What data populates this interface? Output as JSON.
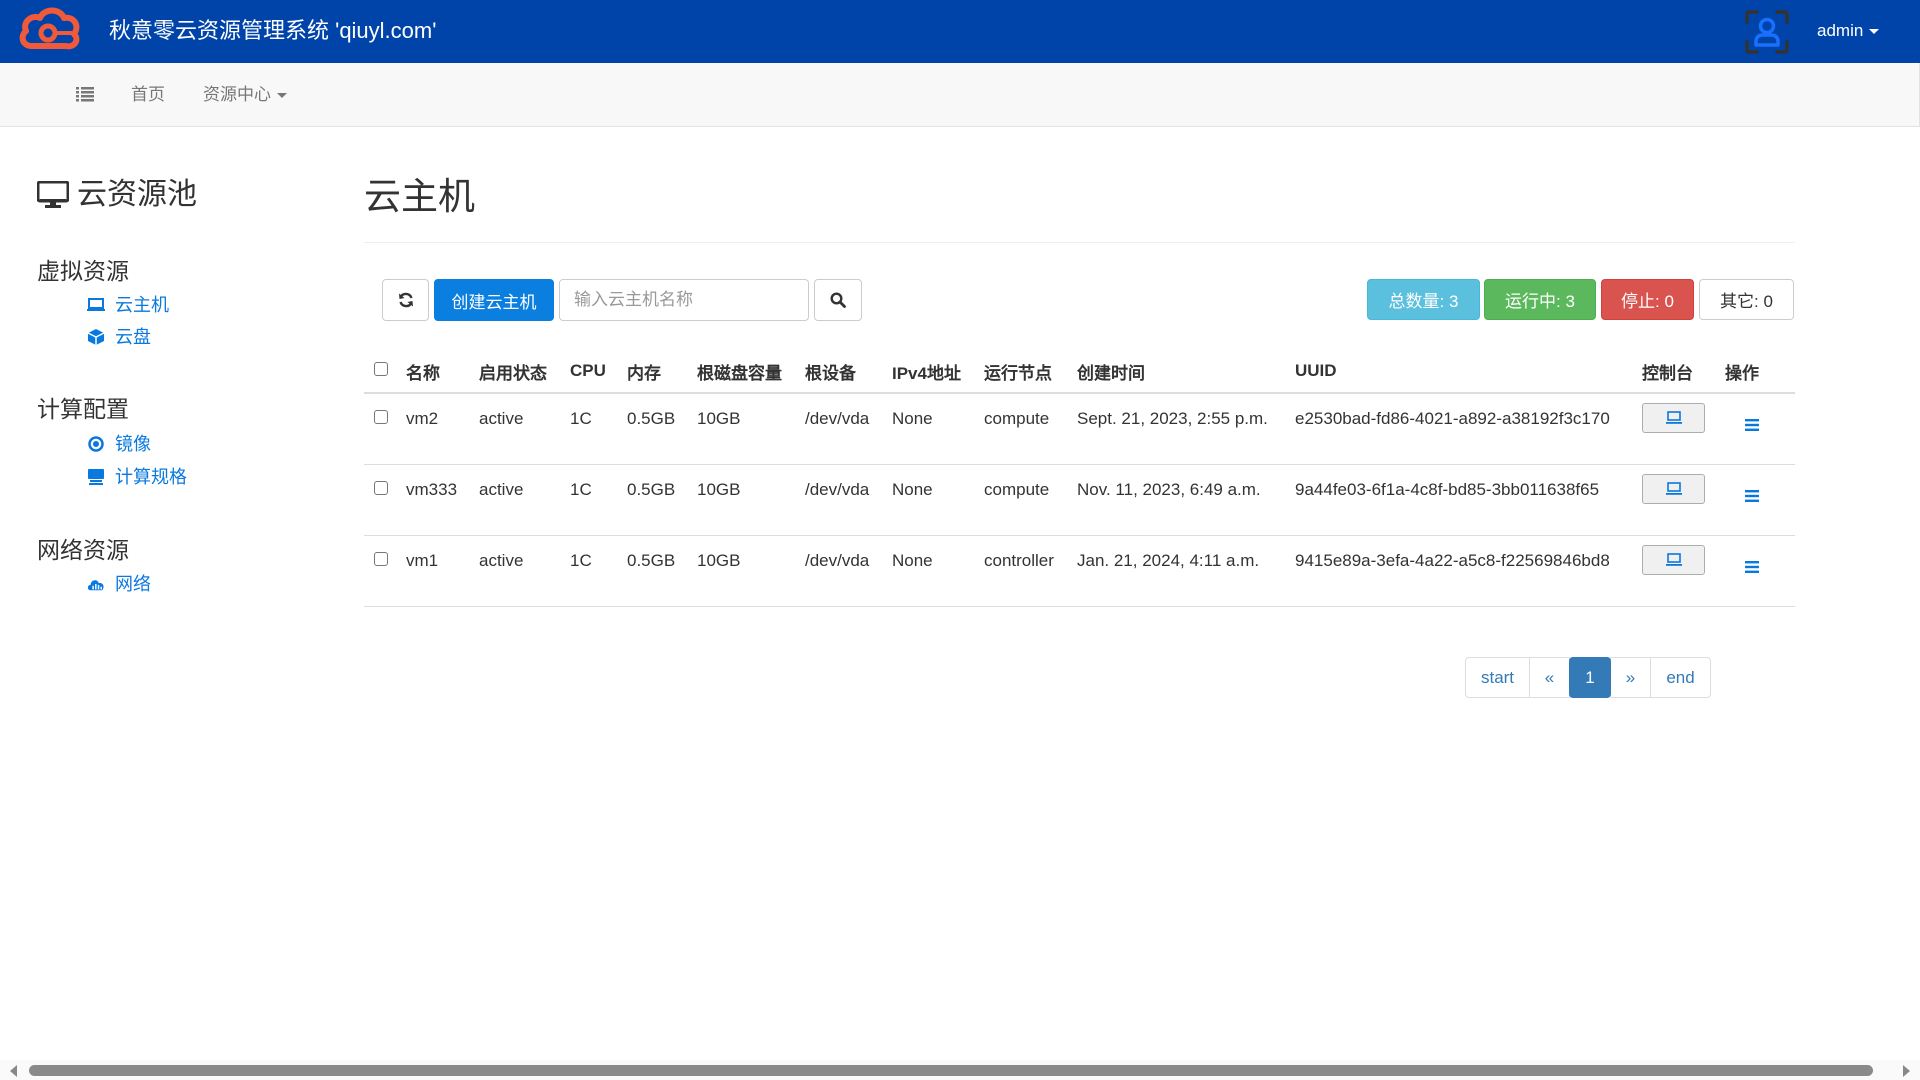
{
  "header": {
    "app_title": "秋意零云资源管理系统 'qiuyl.com'",
    "user_name": "admin",
    "brand_color": "#0044aa",
    "logo_color": "#f05a3a"
  },
  "navbar": {
    "items": [
      {
        "label": "首页"
      },
      {
        "label": "资源中心"
      }
    ]
  },
  "sidebar": {
    "title": "云资源池",
    "groups": [
      {
        "label": "虚拟资源",
        "items": [
          {
            "label": "云主机",
            "icon": "laptop-icon"
          },
          {
            "label": "云盘",
            "icon": "cube-icon"
          }
        ]
      },
      {
        "label": "计算配置",
        "items": [
          {
            "label": "镜像",
            "icon": "record-icon"
          },
          {
            "label": "计算规格",
            "icon": "blackboard-icon"
          }
        ]
      },
      {
        "label": "网络资源",
        "items": [
          {
            "label": "网络",
            "icon": "cloud-chart-icon"
          }
        ]
      }
    ]
  },
  "main": {
    "title": "云主机",
    "toolbar": {
      "create_label": "创建云主机",
      "search_placeholder": "输入云主机名称",
      "search_value": ""
    },
    "stats": [
      {
        "label": "总数量: 3",
        "color": "#5bc0de"
      },
      {
        "label": "运行中: 3",
        "color": "#5cb85c"
      },
      {
        "label": "停止: 0",
        "color": "#d9534f"
      },
      {
        "label": "其它: 0",
        "color": "#ffffff"
      }
    ],
    "table": {
      "columns": [
        "名称",
        "启用状态",
        "CPU",
        "内存",
        "根磁盘容量",
        "根设备",
        "IPv4地址",
        "运行节点",
        "创建时间",
        "UUID",
        "控制台",
        "操作"
      ],
      "rows": [
        {
          "name": "vm2",
          "status": "active",
          "cpu": "1C",
          "memory": "0.5GB",
          "disk": "10GB",
          "root_device": "/dev/vda",
          "ipv4": "None",
          "node": "compute",
          "created": "Sept. 21, 2023, 2:55 p.m.",
          "uuid": "e2530bad-fd86-4021-a892-a38192f3c170"
        },
        {
          "name": "vm333",
          "status": "active",
          "cpu": "1C",
          "memory": "0.5GB",
          "disk": "10GB",
          "root_device": "/dev/vda",
          "ipv4": "None",
          "node": "compute",
          "created": "Nov. 11, 2023, 6:49 a.m.",
          "uuid": "9a44fe03-6f1a-4c8f-bd85-3bb011638f65"
        },
        {
          "name": "vm1",
          "status": "active",
          "cpu": "1C",
          "memory": "0.5GB",
          "disk": "10GB",
          "root_device": "/dev/vda",
          "ipv4": "None",
          "node": "controller",
          "created": "Jan. 21, 2024, 4:11 a.m.",
          "uuid": "9415e89a-3efa-4a22-a5c8-f22569846bd8"
        }
      ]
    },
    "pagination": {
      "start": "start",
      "prev": "«",
      "current": "1",
      "next": "»",
      "end": "end"
    }
  }
}
